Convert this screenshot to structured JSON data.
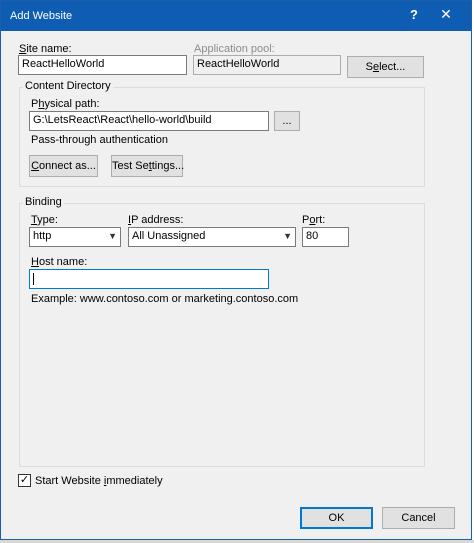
{
  "window": {
    "title": "Add Website",
    "help": "?",
    "close": "✕"
  },
  "site": {
    "name_label_u": "S",
    "name_label_rest": "ite name:",
    "name_value": "ReactHelloWorld",
    "pool_label": "Application pool:",
    "pool_value": "ReactHelloWorld",
    "select_label_pre": "S",
    "select_label_u": "e",
    "select_label_rest": "lect..."
  },
  "content": {
    "group_title": "Content Directory",
    "path_label_pre": "P",
    "path_label_u": "h",
    "path_label_rest": "ysical path:",
    "path_value": "G:\\LetsReact\\React\\hello-world\\build",
    "browse_label": "...",
    "auth_text": "Pass-through authentication",
    "connect_label_pre": "",
    "connect_label_u": "C",
    "connect_label_rest": "onnect as...",
    "test_label_pre": "Test Se",
    "test_label_u": "t",
    "test_label_rest": "tings..."
  },
  "binding": {
    "group_title": "Binding",
    "type_label_u": "T",
    "type_label_rest": "ype:",
    "type_value": "http",
    "ip_label_u": "I",
    "ip_label_rest": "P address:",
    "ip_value": "All Unassigned",
    "port_label_pre": "P",
    "port_label_u": "o",
    "port_label_rest": "rt:",
    "port_value": "80",
    "host_label_u": "H",
    "host_label_rest": "ost name:",
    "host_value": "",
    "example_text": "Example: www.contoso.com or marketing.contoso.com"
  },
  "footer": {
    "start_checked": true,
    "start_label_pre": "Start Website ",
    "start_label_u": "i",
    "start_label_rest": "mmediately",
    "ok_label": "OK",
    "cancel_label": "Cancel"
  },
  "colors": {
    "titlebar": "#0f5db3",
    "dialog_bg": "#f0f0f0",
    "focus": "#0078d7"
  }
}
